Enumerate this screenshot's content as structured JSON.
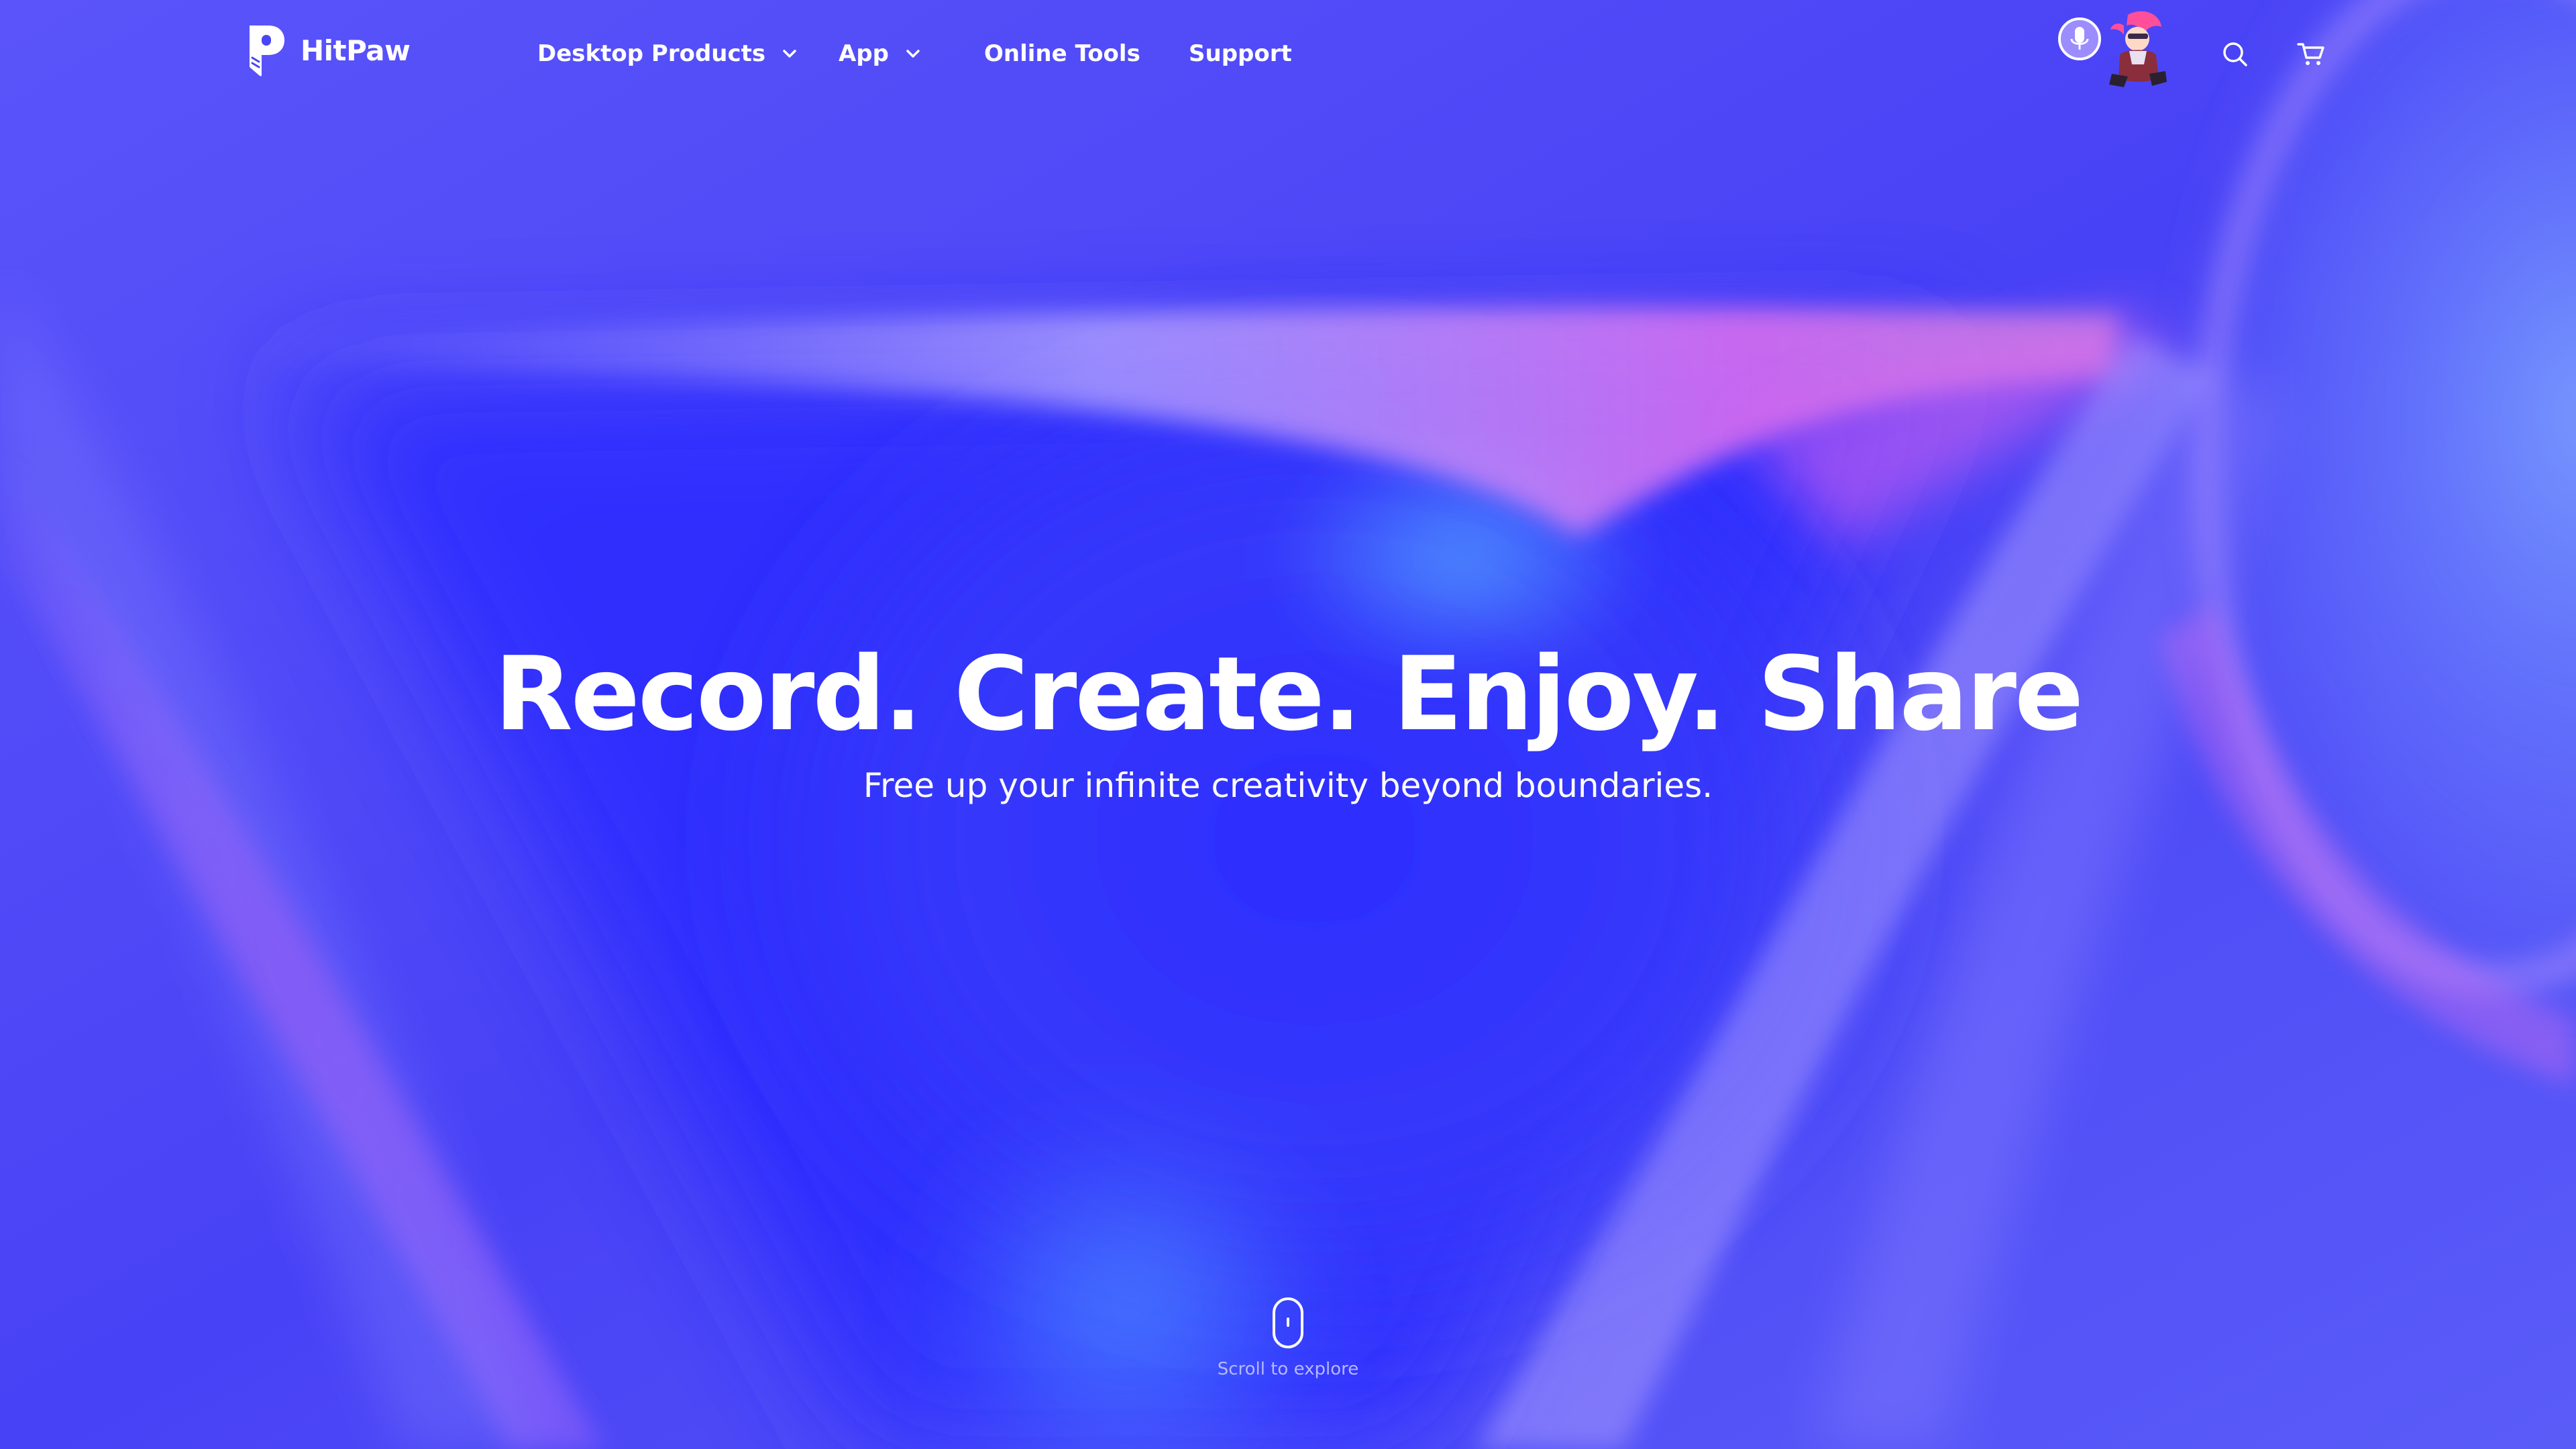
{
  "brand": {
    "name": "HitPaw",
    "logo_icon": "hitpaw-logo-icon"
  },
  "nav": {
    "items": [
      {
        "label": "Desktop Products",
        "has_dropdown": true,
        "icon": "chevron-down-icon"
      },
      {
        "label": "App",
        "has_dropdown": true,
        "icon": "chevron-down-icon"
      },
      {
        "label": "Online Tools",
        "has_dropdown": false
      },
      {
        "label": "Support",
        "has_dropdown": false
      }
    ]
  },
  "header_actions": {
    "mascot": "voice-mascot-icon",
    "search_icon": "search-icon",
    "cart_icon": "cart-icon"
  },
  "hero": {
    "headline": "Record. Create. Enjoy. Share",
    "subheadline": "Free up your infinite creativity beyond boundaries."
  },
  "scroll_hint": {
    "label": "Scroll to explore",
    "icon": "mouse-scroll-icon"
  },
  "colors": {
    "background": "#4a45f5",
    "deep_blue": "#2630ff",
    "magenta_glow": "#d65cf0",
    "cyan_glow": "#6ab8ff",
    "text": "#ffffff",
    "muted_text": "#b5b8ff"
  }
}
